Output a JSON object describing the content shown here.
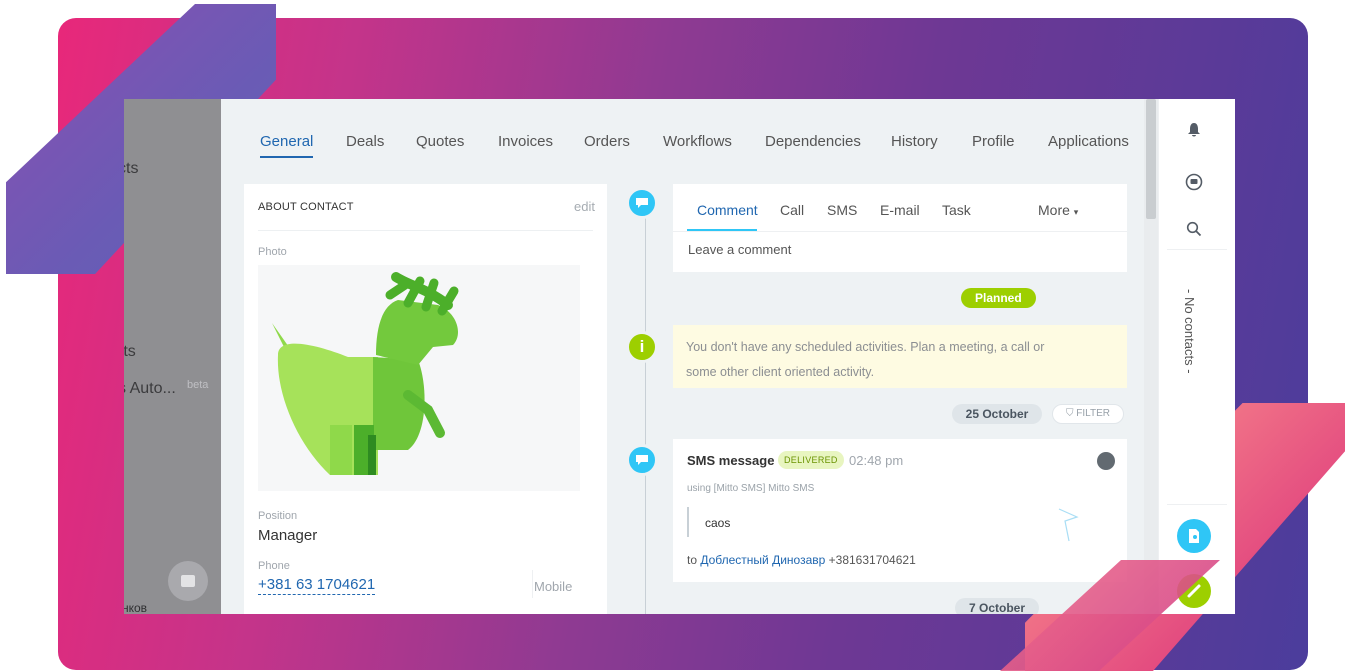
{
  "sidebar_dimmed": {
    "items": [
      "cts",
      "rts",
      "s Auto..."
    ],
    "beta_label": "beta",
    "user_name": "нков"
  },
  "tabs": [
    "General",
    "Deals",
    "Quotes",
    "Invoices",
    "Orders",
    "Workflows",
    "Dependencies",
    "History",
    "Profile",
    "Applications"
  ],
  "about": {
    "title": "ABOUT CONTACT",
    "edit": "edit",
    "photo_label": "Photo",
    "position_label": "Position",
    "position_value": "Manager",
    "phone_label": "Phone",
    "phone_value": "+381 63 1704621",
    "phone_type": "Mobile"
  },
  "composer": {
    "tabs": [
      "Comment",
      "Call",
      "SMS",
      "E-mail",
      "Task"
    ],
    "more": "More",
    "placeholder": "Leave a comment"
  },
  "timeline": {
    "planned_label": "Planned",
    "notice": "You don't have any scheduled activities. Plan a meeting, a call or some other client oriented activity.",
    "date_1": "25 October",
    "filter_label": "FILTER",
    "sms": {
      "title": "SMS message",
      "status": "DELIVERED",
      "time": "02:48 pm",
      "via": "using [Mitto SMS] Mitto SMS",
      "message": "caos",
      "to_prefix": "to",
      "to_name": "Доблестный Динозавр",
      "to_number": "+381631704621"
    },
    "date_2": "7 October"
  },
  "right_panel": {
    "no_contacts": "- No contacts -"
  },
  "colors": {
    "accent": "#2067b0",
    "timeline_icon": "#2fc6f6",
    "planned": "#9dcf00",
    "call_button": "#9dcf00"
  }
}
